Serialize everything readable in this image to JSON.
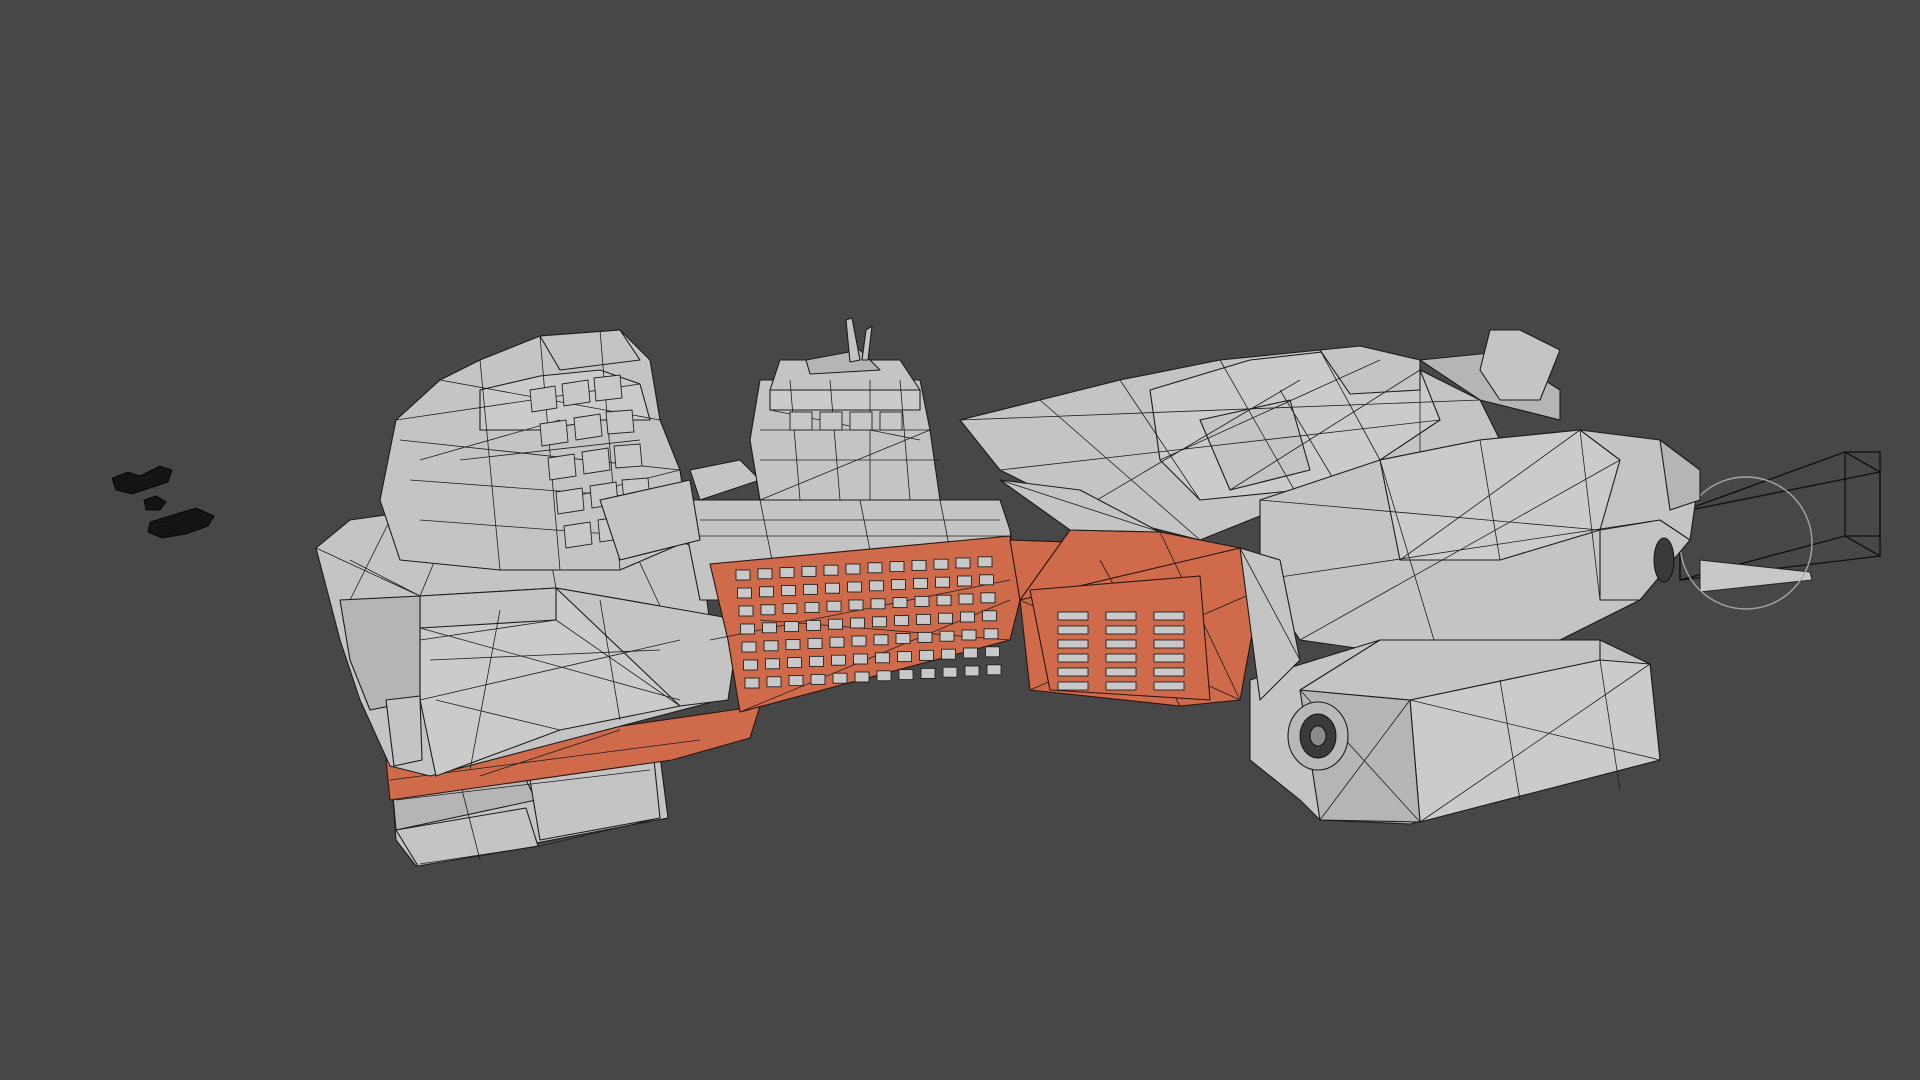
{
  "viewport": {
    "background": "#474747",
    "shading_mode": "solid-wireframe",
    "mesh_color": "#c4c4c4",
    "selection_color": "#cf6a4a",
    "wire_color": "#1c1c1c"
  },
  "scene": {
    "objects": [
      {
        "name": "spaceship-mesh",
        "selected_faces": "mid-hull-panels"
      },
      {
        "name": "debris-fragments"
      },
      {
        "name": "camera-object"
      },
      {
        "name": "light-gizmo"
      }
    ]
  }
}
